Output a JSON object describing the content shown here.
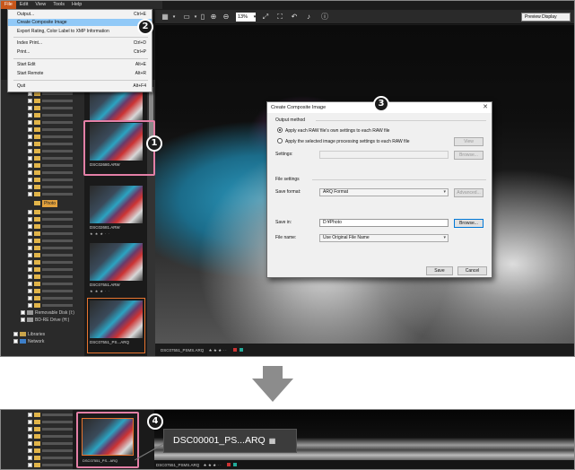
{
  "menubar": {
    "items": [
      "File",
      "Edit",
      "View",
      "Tools",
      "Help"
    ]
  },
  "file_menu": {
    "items": [
      {
        "label": "Output...",
        "shortcut": "Ctrl+E"
      },
      {
        "label": "Create Composite Image",
        "shortcut": ""
      },
      {
        "label": "Export Rating, Color Label to XMP Information",
        "shortcut": ""
      },
      {
        "label": "Index Print...",
        "shortcut": "Ctrl+D"
      },
      {
        "label": "Print...",
        "shortcut": "Ctrl+P"
      },
      {
        "label": "Start Edit",
        "shortcut": "Alt+E"
      },
      {
        "label": "Start Remote",
        "shortcut": "Alt+R"
      },
      {
        "label": "Quit",
        "shortcut": "Alt+F4"
      }
    ]
  },
  "toolbar": {
    "zoom": "13%",
    "preview_mode": "Preview Display"
  },
  "tree": {
    "highlighted_folder": "Photo",
    "removable_disk": "Removable Disk (I:)",
    "bdre_drive": "BD-RE Drive (H:)",
    "libraries": "Libraries",
    "network": "Network"
  },
  "thumbnails": [
    {
      "name": "DSC02678.ARW",
      "stars": "★ ★ ★ · ·"
    },
    {
      "name": "DSC02680.ARW",
      "stars": ""
    },
    {
      "name": "DSC02681.ARW",
      "stars": "★ ★ ★ · ·"
    },
    {
      "name": "DSC07551.ARW",
      "stars": "★ ★ ★ · ·"
    },
    {
      "name": "DSC07551_PS...ARQ",
      "stars": ""
    }
  ],
  "status": {
    "filename": "DSC07551_PSMS.ARQ",
    "stars": "★ ★ ★ · ·"
  },
  "dialog": {
    "title": "Create Composite Image",
    "output_method_label": "Output method",
    "option_each_raw": "Apply each RAW file's own settings to each RAW file",
    "option_selected": "Apply the selected image processing settings to each RAW file",
    "view_button": "View",
    "settings_label": "Settings:",
    "browse_disabled": "Browse...",
    "file_settings_label": "File settings",
    "save_format_label": "Save format:",
    "save_format_value": "ARQ Format",
    "advanced_button": "Advanced...",
    "save_in_label": "Save in:",
    "save_in_value": "D:¥Photo",
    "browse_button": "Browse...",
    "file_name_label": "File name:",
    "file_name_value": "Use Original File Name",
    "save_button": "Save",
    "cancel_button": "Cancel"
  },
  "callouts": [
    "1",
    "2",
    "3",
    "4"
  ],
  "bottom": {
    "thumb_caption": "DSC07551_PS...ARQ",
    "status_filename": "DSC07551_PSMS.ARQ",
    "status_stars": "★ ★ ★ · ·",
    "tooltip": "DSC00001_PS...ARQ"
  }
}
